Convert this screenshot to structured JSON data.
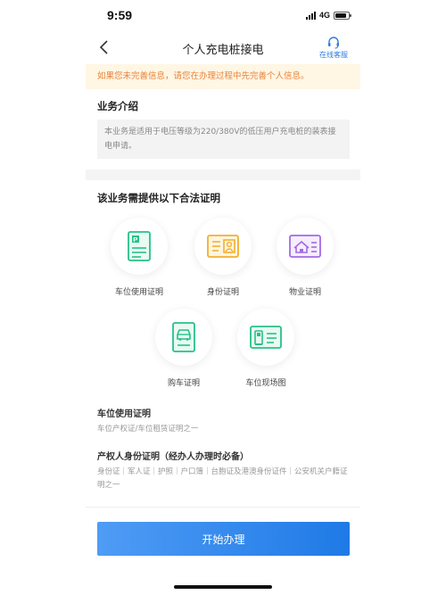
{
  "status_bar": {
    "time": "9:59",
    "network": "4G",
    "battery_level": 0.85
  },
  "nav": {
    "title": "个人充电桩接电",
    "service_label": "在线客服"
  },
  "notice": {
    "text": "如果您未完善信息，请您在办理过程中先完善个人信息。"
  },
  "intro": {
    "title": "业务介绍",
    "text": "本业务是适用于电压等级为220/380V的低压用户充电桩的装表接电申请。"
  },
  "certs": {
    "title": "该业务需提供以下合法证明",
    "items": [
      {
        "label": "车位使用证明",
        "icon": "parking-doc-icon",
        "color": "#27c08a"
      },
      {
        "label": "身份证明",
        "icon": "id-card-icon",
        "color": "#f2b030"
      },
      {
        "label": "物业证明",
        "icon": "property-house-icon",
        "color": "#a46ae4"
      },
      {
        "label": "购车证明",
        "icon": "car-doc-icon",
        "color": "#27c08a"
      },
      {
        "label": "车位现场图",
        "icon": "charger-photo-icon",
        "color": "#27c08a"
      }
    ]
  },
  "requirements": [
    {
      "title": "车位使用证明",
      "desc": "车位产权证/车位租赁证明之一"
    },
    {
      "title": "产权人身份证明（经办人办理时必备）",
      "desc": "身份证｜军人证｜护照｜户口簿｜台胞证及港澳身份证件｜公安机关户籍证明之一"
    }
  ],
  "actions": {
    "start_label": "开始办理"
  },
  "colors": {
    "accent": "#2f7de1",
    "notice_text": "#e8833a",
    "notice_bg": "#fff6e4",
    "button_start": "#4f9cf5",
    "button_end": "#1f7ae6"
  }
}
